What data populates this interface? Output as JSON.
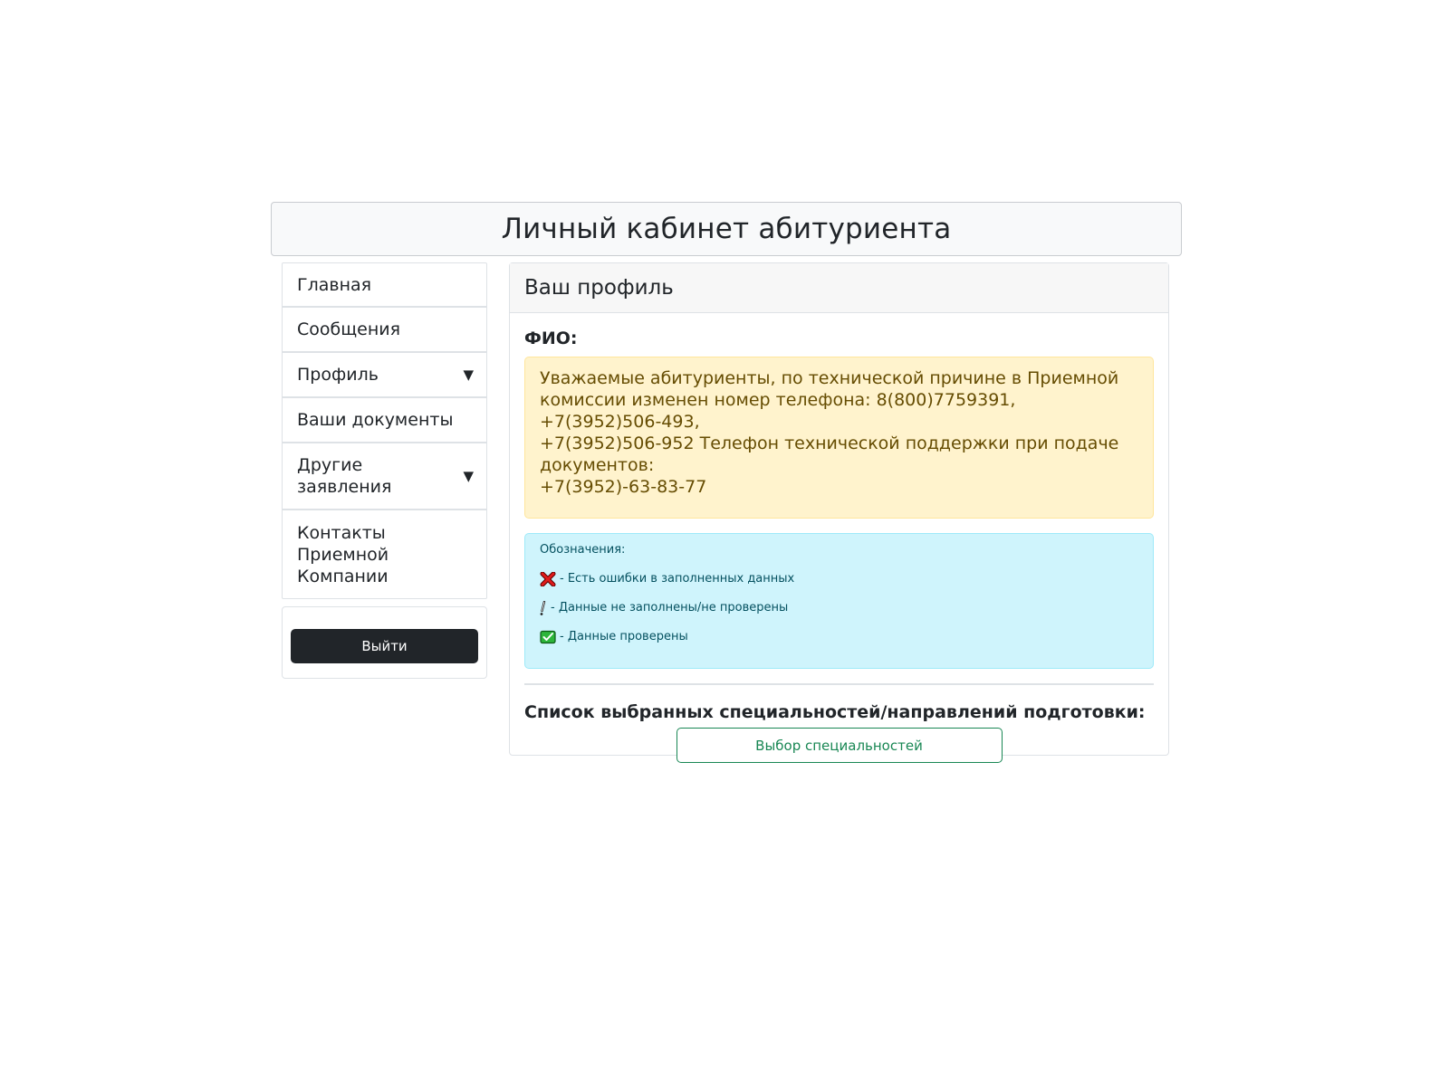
{
  "header": {
    "title": "Личный кабинет абитуриента"
  },
  "sidebar": {
    "items": [
      {
        "label": "Главная",
        "has_dropdown": false
      },
      {
        "label": "Сообщения",
        "has_dropdown": false
      },
      {
        "label": "Профиль",
        "has_dropdown": true
      },
      {
        "label": "Ваши документы",
        "has_dropdown": false
      },
      {
        "label": "Другие\nзаявления",
        "has_dropdown": true
      },
      {
        "label": "Контакты\nПриемной\nКомпании",
        "has_dropdown": false
      }
    ],
    "caret": "▼",
    "logout_label": "Выйти"
  },
  "main": {
    "card_title": "Ваш профиль",
    "fio_label": "ФИО:",
    "notice": {
      "lines": [
        "Уважаемые абитуриенты, по технической причине в Приемной",
        "комиссии изменен номер телефона: 8(800)7759391, +7(3952)506-493,",
        "+7(3952)506-952 Телефон технической поддержки при подаче",
        "документов:",
        "+7(3952)-63-83-77"
      ]
    },
    "legend": {
      "title": "Обозначения:",
      "items": [
        {
          "icon": "red-cross-icon",
          "text": "- Есть ошибки в заполненных данных"
        },
        {
          "icon": "exclamation-icon",
          "text": "- Данные не заполнены/не проверены"
        },
        {
          "icon": "green-check-icon",
          "text": "- Данные проверены"
        }
      ]
    },
    "list_title": "Список выбранных специальностей/направлений подготовки:",
    "choose_button": "Выбор специальностей"
  },
  "colors": {
    "warning_bg": "#fff3cd",
    "info_bg": "#cff4fc",
    "success": "#198754",
    "dark_button": "#212529"
  }
}
